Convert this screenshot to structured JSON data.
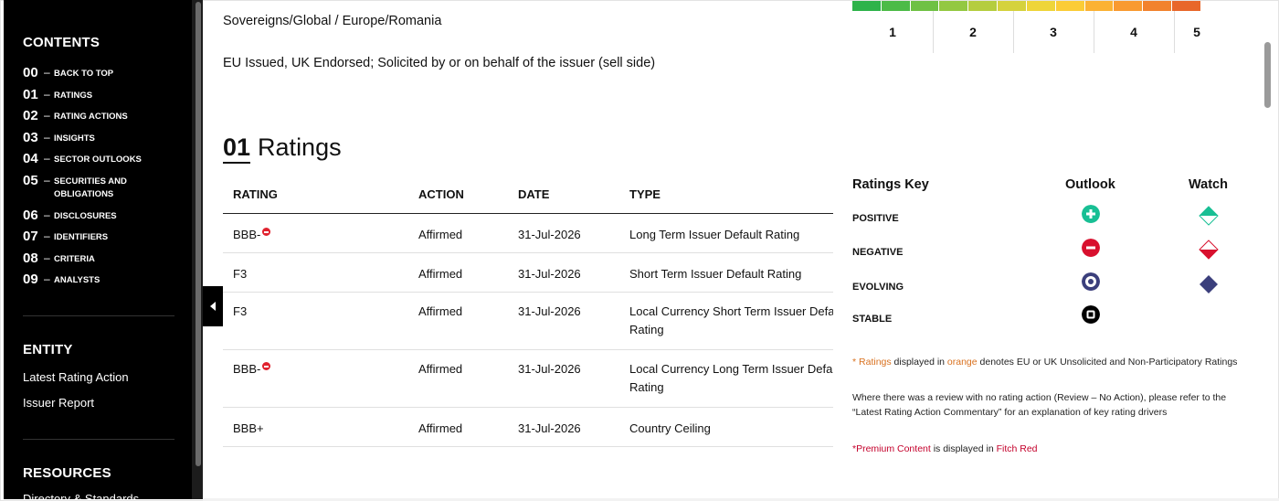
{
  "sidebar": {
    "contents_heading": "CONTENTS",
    "toc": [
      {
        "num": "00",
        "label": "BACK TO TOP"
      },
      {
        "num": "01",
        "label": "RATINGS"
      },
      {
        "num": "02",
        "label": "RATING ACTIONS"
      },
      {
        "num": "03",
        "label": "INSIGHTS"
      },
      {
        "num": "04",
        "label": "SECTOR OUTLOOKS"
      },
      {
        "num": "05",
        "label": "SECURITIES AND OBLIGATIONS"
      },
      {
        "num": "06",
        "label": "DISCLOSURES"
      },
      {
        "num": "07",
        "label": "IDENTIFIERS"
      },
      {
        "num": "08",
        "label": "CRITERIA"
      },
      {
        "num": "09",
        "label": "ANALYSTS"
      }
    ],
    "dash": "–",
    "entity_heading": "ENTITY",
    "entity_links": [
      "Latest Rating Action",
      "Issuer Report"
    ],
    "resources_heading": "RESOURCES",
    "resources_partial": "Directory & Standards"
  },
  "main": {
    "sector_path": "Sovereigns/Global / Europe/Romania",
    "endorsement": "EU Issued, UK Endorsed; Solicited by or on behalf of the issuer (sell side)",
    "section_num": "01",
    "section_title": "Ratings",
    "table": {
      "headers": [
        "RATING",
        "ACTION",
        "DATE",
        "TYPE"
      ],
      "rows": [
        {
          "rating": "BBB-",
          "negative": true,
          "action": "Affirmed",
          "date": "31-Jul-2026",
          "type": "Long Term Issuer Default Rating"
        },
        {
          "rating": "F3",
          "negative": false,
          "action": "Affirmed",
          "date": "31-Jul-2026",
          "type": "Short Term Issuer Default Rating"
        },
        {
          "rating": "F3",
          "negative": false,
          "action": "Affirmed",
          "date": "31-Jul-2026",
          "type": "Local Currency Short Term Issuer Default Rating"
        },
        {
          "rating": "BBB-",
          "negative": true,
          "action": "Affirmed",
          "date": "31-Jul-2026",
          "type": "Local Currency Long Term Issuer Default Rating"
        },
        {
          "rating": "BBB+",
          "negative": false,
          "action": "Affirmed",
          "date": "31-Jul-2026",
          "type": "Country Ceiling"
        }
      ]
    }
  },
  "scale": {
    "labels": [
      "1",
      "2",
      "3",
      "4",
      "5"
    ],
    "colors": [
      "#2eb34a",
      "#4cbb47",
      "#6fc144",
      "#93c841",
      "#b5cd3f",
      "#d5d23d",
      "#eed53a",
      "#fbcc36",
      "#fbb233",
      "#f99a30",
      "#f2822d",
      "#e8672a"
    ]
  },
  "key": {
    "heading": "Ratings Key",
    "outlook_heading": "Outlook",
    "watch_heading": "Watch",
    "items": [
      {
        "label": "POSITIVE",
        "outlook_icon": "positive-outlook-icon",
        "watch_icon": "positive-watch-icon"
      },
      {
        "label": "NEGATIVE",
        "outlook_icon": "negative-outlook-icon",
        "watch_icon": "negative-watch-icon"
      },
      {
        "label": "EVOLVING",
        "outlook_icon": "evolving-outlook-icon",
        "watch_icon": "evolving-watch-icon"
      },
      {
        "label": "STABLE",
        "outlook_icon": "stable-outlook-icon",
        "watch_icon": ""
      }
    ],
    "colors": {
      "positive": "#18bf94",
      "negative": "#d8102e",
      "evolving": "#3b3f7c",
      "stable": "#000000"
    }
  },
  "notes": {
    "asterisk": "* ",
    "ratings_word": "Ratings",
    "displayed_in": " displayed in ",
    "orange_word": "orange",
    "denotes": " denotes EU or UK Unsolicited and Non-Participatory Ratings",
    "review_note_1": "Where there was a review with no rating action (Review – No Action), please refer to the",
    "review_note_2": "“Latest Rating Action Commentary” for an explanation of key rating drivers",
    "premium": "*Premium Content",
    "premium_mid": " is displayed in ",
    "fitch_red": "Fitch Red"
  }
}
